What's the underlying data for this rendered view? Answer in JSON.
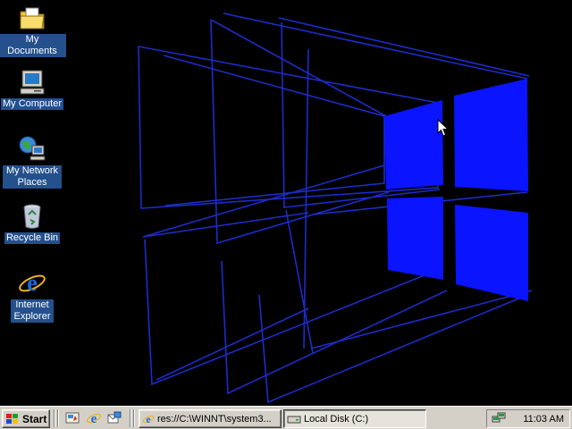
{
  "desktop": {
    "icons": [
      {
        "label": "My Documents",
        "icon": "folder-documents-icon"
      },
      {
        "label": "My Computer",
        "icon": "computer-icon"
      },
      {
        "label": "My Network Places",
        "icon": "network-places-icon"
      },
      {
        "label": "Recycle Bin",
        "icon": "recycle-bin-icon"
      },
      {
        "label": "Internet Explorer",
        "icon": "internet-explorer-icon"
      }
    ],
    "wallpaper": {
      "style": "3d windows logo",
      "accent": "#0a14ff",
      "line_color": "#1c2cc8"
    }
  },
  "taskbar": {
    "start_label": "Start",
    "quick_launch": [
      "show-desktop-icon",
      "internet-explorer-icon",
      "outlook-express-icon"
    ],
    "tasks": [
      {
        "label": "res://C:\\WINNT\\system3...",
        "icon": "internet-explorer-icon",
        "active": false
      },
      {
        "label": "Local Disk (C:)",
        "icon": "drive-icon",
        "active": true
      }
    ],
    "tray": {
      "icons": [
        "network-tray-icon"
      ],
      "clock": "11:03 AM"
    }
  }
}
